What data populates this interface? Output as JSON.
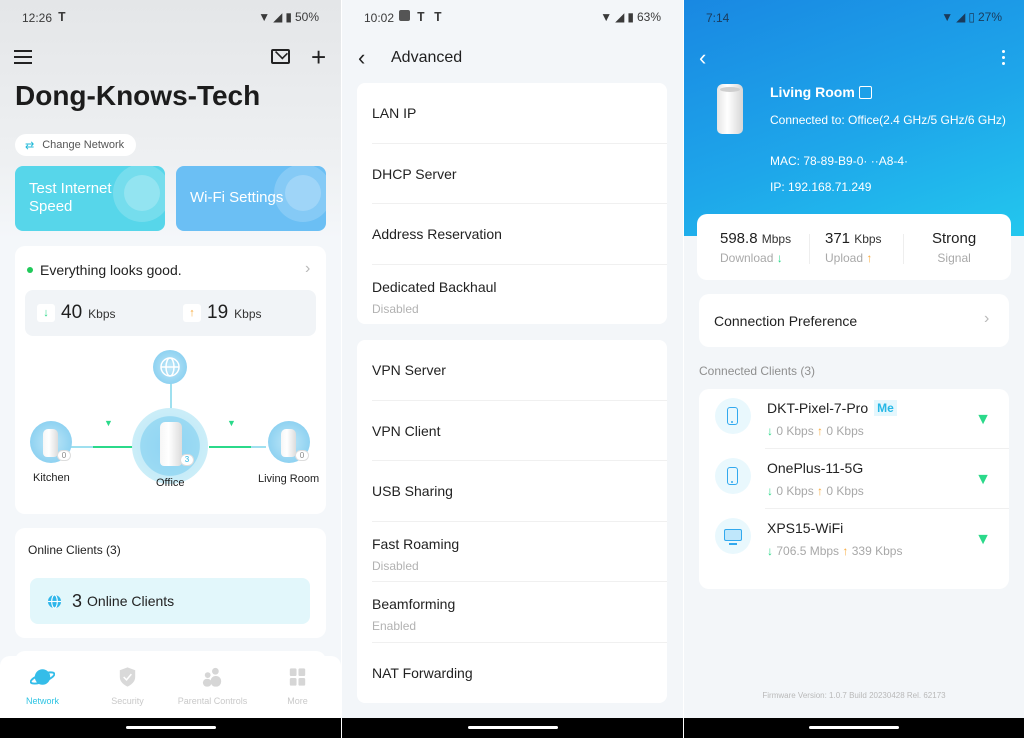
{
  "screens": [
    {
      "status": {
        "time": "12:26",
        "battery": "50%"
      },
      "header": {
        "network_name": "Dong-Knows-Tech",
        "change_network_label": "Change Network"
      },
      "tiles": [
        {
          "label_line1": "Test Internet",
          "label_line2": "Speed"
        },
        {
          "label": "Wi-Fi Settings"
        }
      ],
      "status_card": {
        "message": "Everything looks good.",
        "download_value": "40",
        "download_unit": "Kbps",
        "upload_value": "19",
        "upload_unit": "Kbps"
      },
      "topology": {
        "nodes": [
          {
            "name": "Kitchen",
            "clients": "0"
          },
          {
            "name": "Office",
            "clients": "3"
          },
          {
            "name": "Living Room",
            "clients": "0"
          }
        ]
      },
      "online_clients": {
        "heading": "Online Clients (3)",
        "count": "3",
        "label": "Online Clients"
      },
      "tabbar": [
        {
          "label": "Network",
          "active": true
        },
        {
          "label": "Security"
        },
        {
          "label": "Parental Controls"
        },
        {
          "label": "More"
        }
      ]
    },
    {
      "status": {
        "time": "10:02",
        "battery": "63%"
      },
      "title": "Advanced",
      "groups": [
        [
          {
            "label": "LAN IP"
          },
          {
            "label": "DHCP Server"
          },
          {
            "label": "Address Reservation"
          },
          {
            "label": "Dedicated Backhaul",
            "sub": "Disabled"
          }
        ],
        [
          {
            "label": "VPN Server"
          },
          {
            "label": "VPN Client"
          },
          {
            "label": "USB Sharing"
          },
          {
            "label": "Fast Roaming",
            "sub": "Disabled"
          },
          {
            "label": "Beamforming",
            "sub": "Enabled"
          },
          {
            "label": "NAT Forwarding"
          }
        ]
      ]
    },
    {
      "status": {
        "time": "7:14",
        "battery": "27%"
      },
      "device": {
        "name": "Living Room",
        "connected_to": "Connected to: Office(2.4 GHz/5 GHz/6 GHz)",
        "mac": "MAC: 78-89-B9-0· ··A8-4·",
        "ip": "IP: 192.168.71.249"
      },
      "stats": [
        {
          "value": "598.8",
          "unit": "Mbps",
          "label": "Download"
        },
        {
          "value": "371",
          "unit": "Kbps",
          "label": "Upload"
        },
        {
          "value": "Strong",
          "label": "Signal"
        }
      ],
      "connection_preference": "Connection Preference",
      "clients_heading": "Connected Clients (3)",
      "clients": [
        {
          "name": "DKT-Pixel-7-Pro",
          "tag": "Me",
          "down": "0 Kbps",
          "up": "0 Kbps",
          "type": "phone"
        },
        {
          "name": "OnePlus-11-5G",
          "down": "0 Kbps",
          "up": "0 Kbps",
          "type": "phone"
        },
        {
          "name": "XPS15-WiFi",
          "down": "706.5 Mbps",
          "up": "339 Kbps",
          "type": "computer"
        }
      ],
      "firmware": "Firmware Version: 1.0.7 Build 20230428 Rel. 62173"
    }
  ],
  "colors": {
    "accent": "#2fc4e3",
    "green": "#2bd98a",
    "orange": "#f8a93a",
    "hero_blue": "#1988e2"
  }
}
